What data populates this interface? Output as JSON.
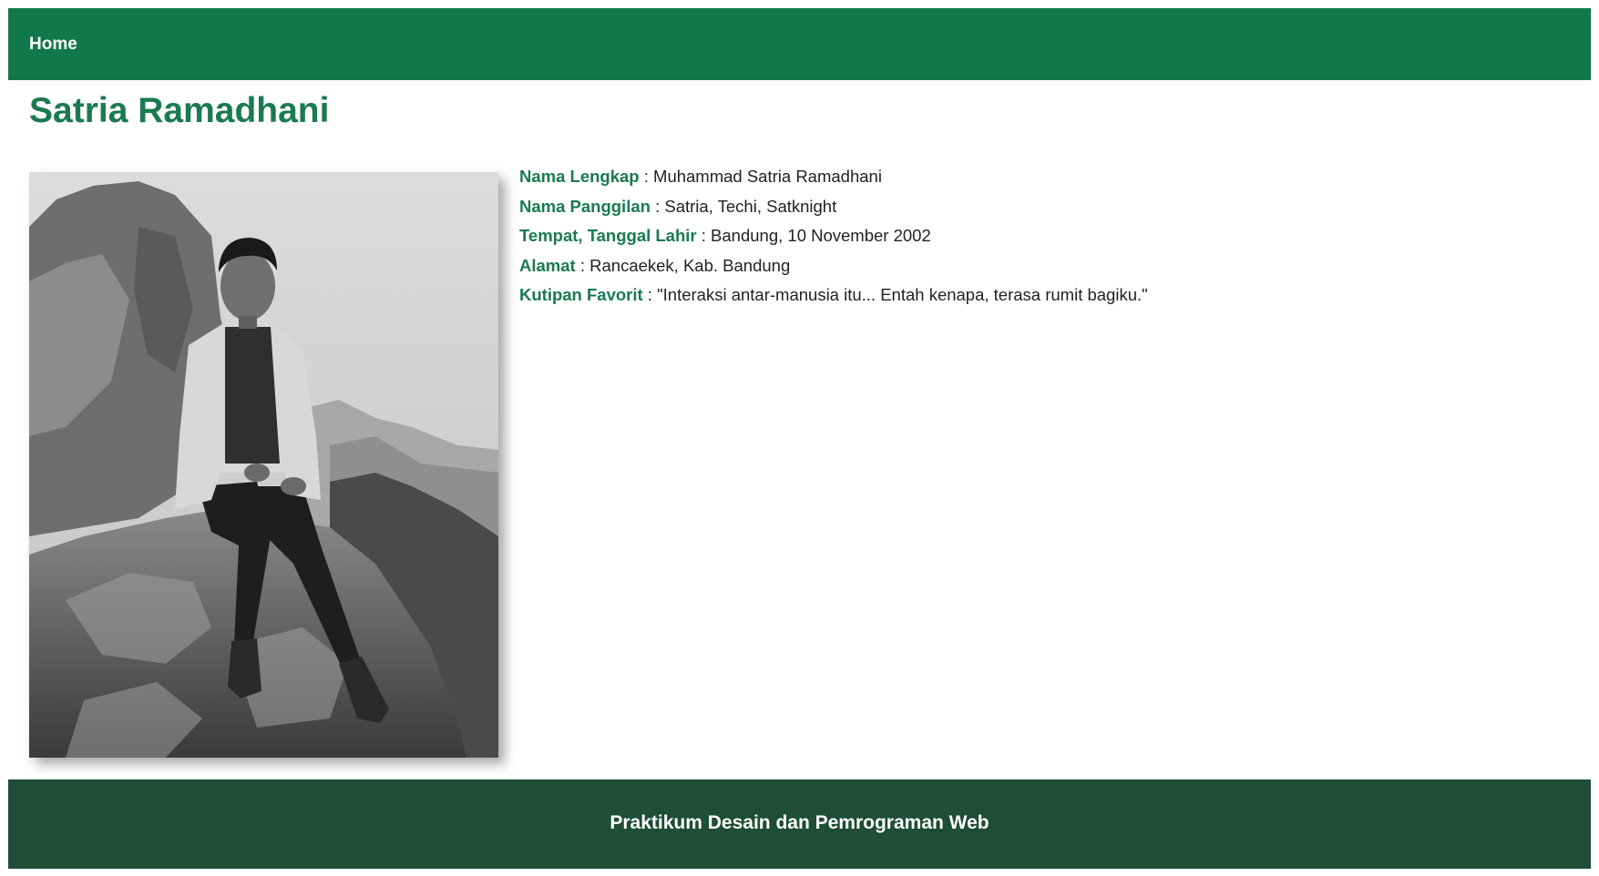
{
  "nav": {
    "home_label": "Home"
  },
  "page": {
    "title": "Satria Ramadhani"
  },
  "photo": {
    "icon": "profile-photo"
  },
  "profile": {
    "rows": [
      {
        "label": "Nama Lengkap",
        "value": "Muhammad Satria Ramadhani"
      },
      {
        "label": "Nama Panggilan",
        "value": "Satria, Techi, Satknight"
      },
      {
        "label": "Tempat, Tanggal Lahir",
        "value": "Bandung, 10 November 2002"
      },
      {
        "label": "Alamat",
        "value": "Rancaekek, Kab. Bandung"
      },
      {
        "label": "Kutipan Favorit",
        "value": "\"Interaksi antar-manusia itu... Entah kenapa, terasa rumit bagiku.\""
      }
    ],
    "separator": " : "
  },
  "footer": {
    "text": "Praktikum Desain dan Pemrograman Web"
  },
  "colors": {
    "navbar": "#11774d",
    "accent": "#1a7a50",
    "footer": "#1e4d38"
  }
}
